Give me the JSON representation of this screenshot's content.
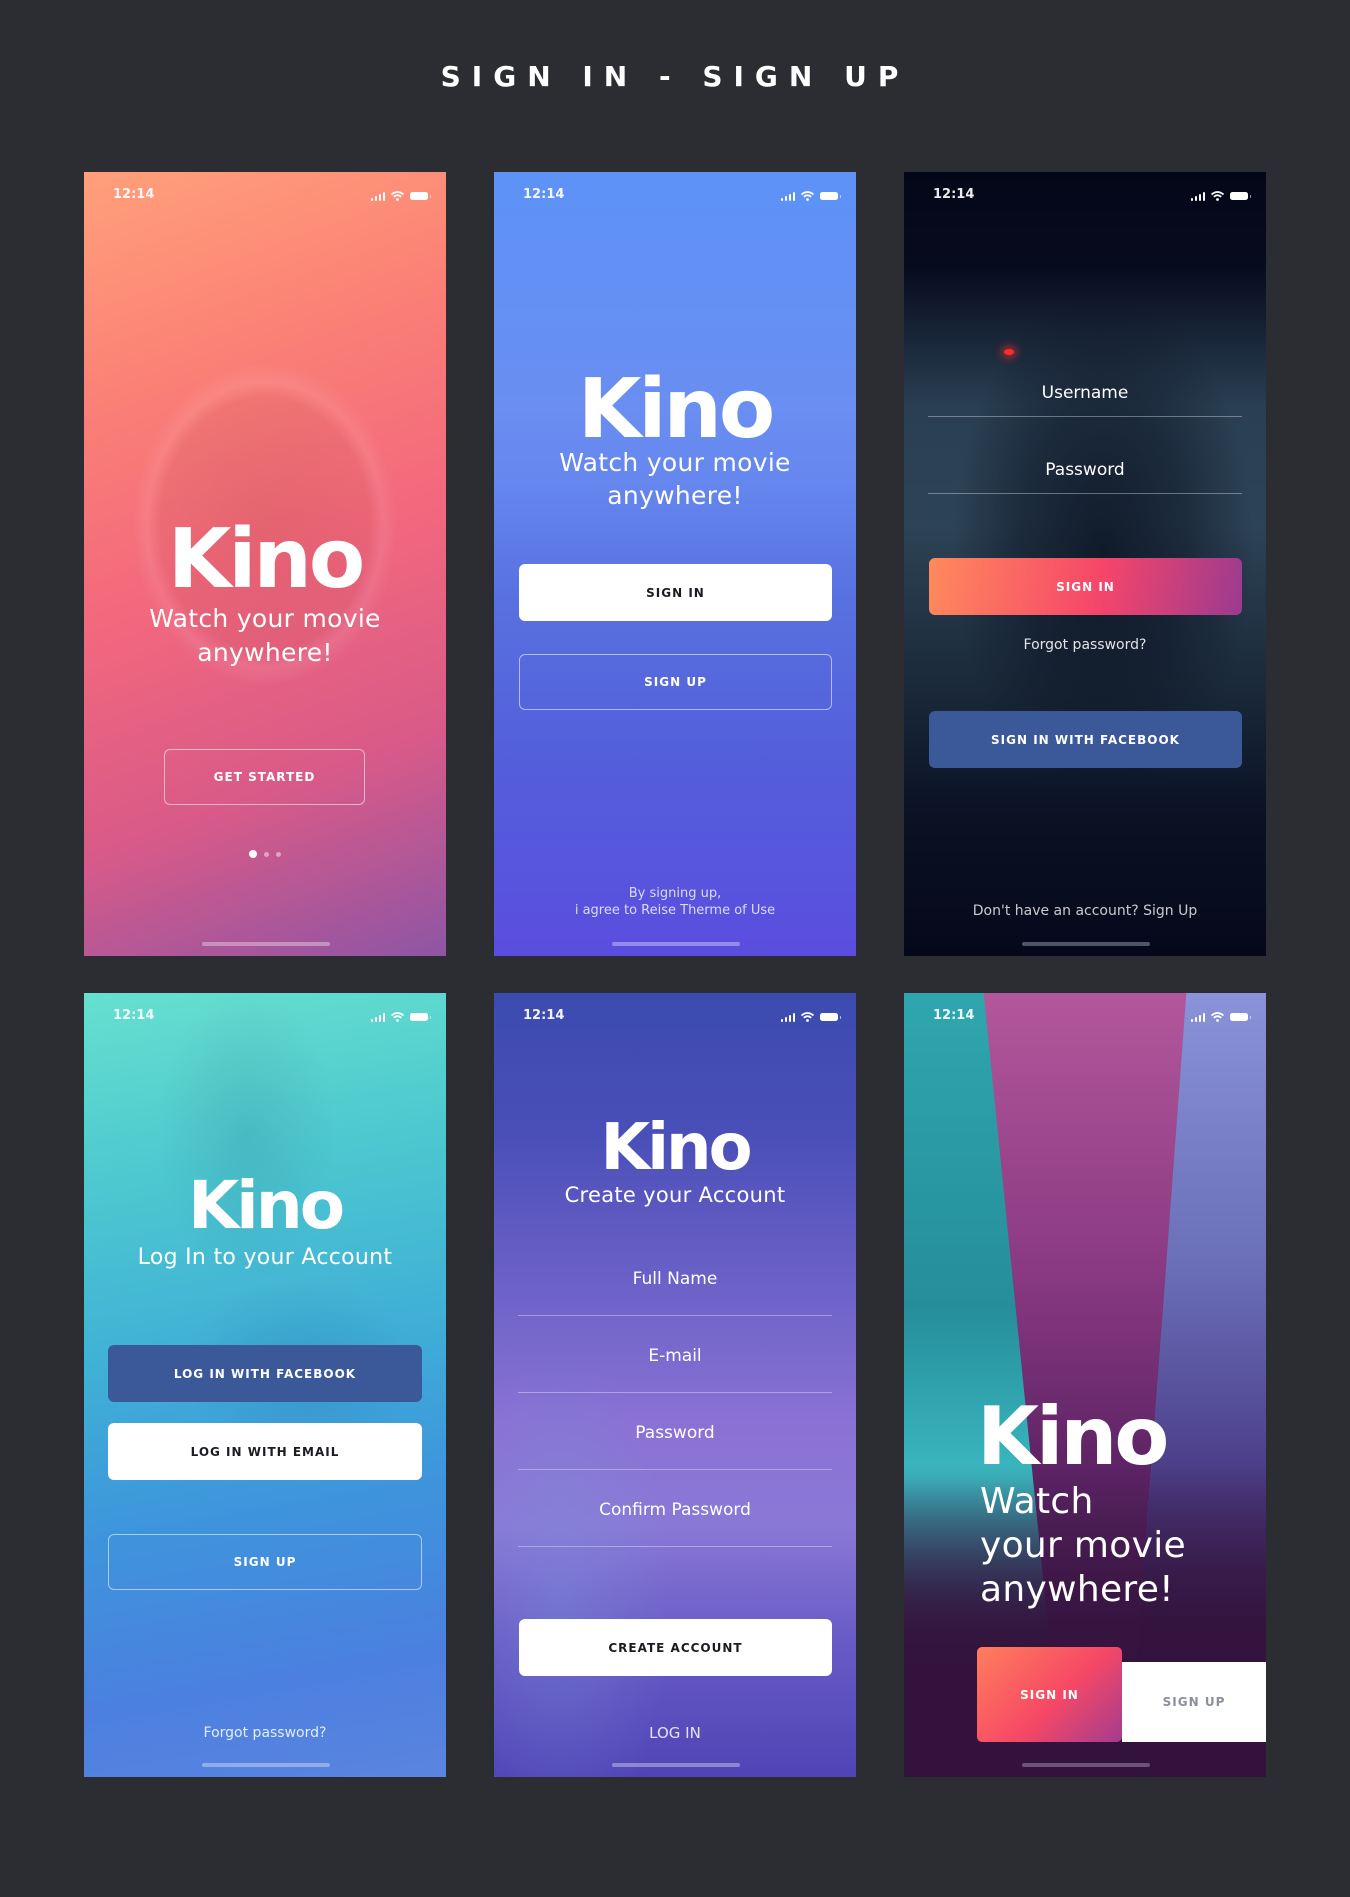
{
  "page": {
    "title": "SIGN IN - SIGN UP"
  },
  "status_bar": {
    "time": "12:14",
    "icons": [
      "signal-icon",
      "wifi-icon",
      "battery-icon"
    ]
  },
  "screens": {
    "onboarding": {
      "logo": "Kino",
      "tagline_line1": "Watch your movie",
      "tagline_line2": "anywhere!",
      "get_started": "GET STARTED",
      "pagination": {
        "current": 1,
        "total": 3
      },
      "colors": {
        "top": "#ff9a76",
        "middle": "#f36b7f",
        "bottom": "#8e54a3"
      }
    },
    "welcome": {
      "logo": "Kino",
      "tagline_line1": "Watch your movie",
      "tagline_line2": "anywhere!",
      "sign_in": "SIGN IN",
      "sign_up": "SIGN UP",
      "terms_line1": "By signing up,",
      "terms_line2": "i agree to Reise Therme of Use",
      "colors": {
        "top": "#5f8ff5",
        "bottom": "#5a4de0"
      }
    },
    "sign_in": {
      "username_placeholder": "Username",
      "password_placeholder": "Password",
      "sign_in": "SIGN IN",
      "forgot_password": "Forgot password?",
      "facebook": "SIGN IN WITH FACEBOOK",
      "footer": "Don't have an account? Sign Up",
      "colors": {
        "background": "#050818",
        "facebook": "#3b5998"
      }
    },
    "login_options": {
      "logo": "Kino",
      "subtitle": "Log In to your Account",
      "facebook": "LOG IN WITH FACEBOOK",
      "email": "LOG IN WITH EMAIL",
      "sign_up": "SIGN UP",
      "forgot_password": "Forgot password?",
      "colors": {
        "top": "#5edbd0",
        "bottom": "#4a7ae0"
      }
    },
    "create_account": {
      "logo": "Kino",
      "subtitle": "Create your Account",
      "fields": [
        {
          "placeholder": "Full Name"
        },
        {
          "placeholder": "E-mail"
        },
        {
          "placeholder": "Password"
        },
        {
          "placeholder": "Confirm Password"
        }
      ],
      "create": "CREATE ACCOUNT",
      "log_in": "LOG IN",
      "colors": {
        "top": "#4b4fb8",
        "bottom": "#6b4fc8"
      }
    },
    "landing": {
      "logo": "Kino",
      "tagline_line1": "Watch",
      "tagline_line2": "your movie",
      "tagline_line3": "anywhere!",
      "sign_in": "SIGN IN",
      "sign_up": "SIGN UP",
      "colors": {
        "teal": "#3fb6be",
        "magenta": "#a0438f",
        "dark": "#35153f"
      }
    }
  }
}
